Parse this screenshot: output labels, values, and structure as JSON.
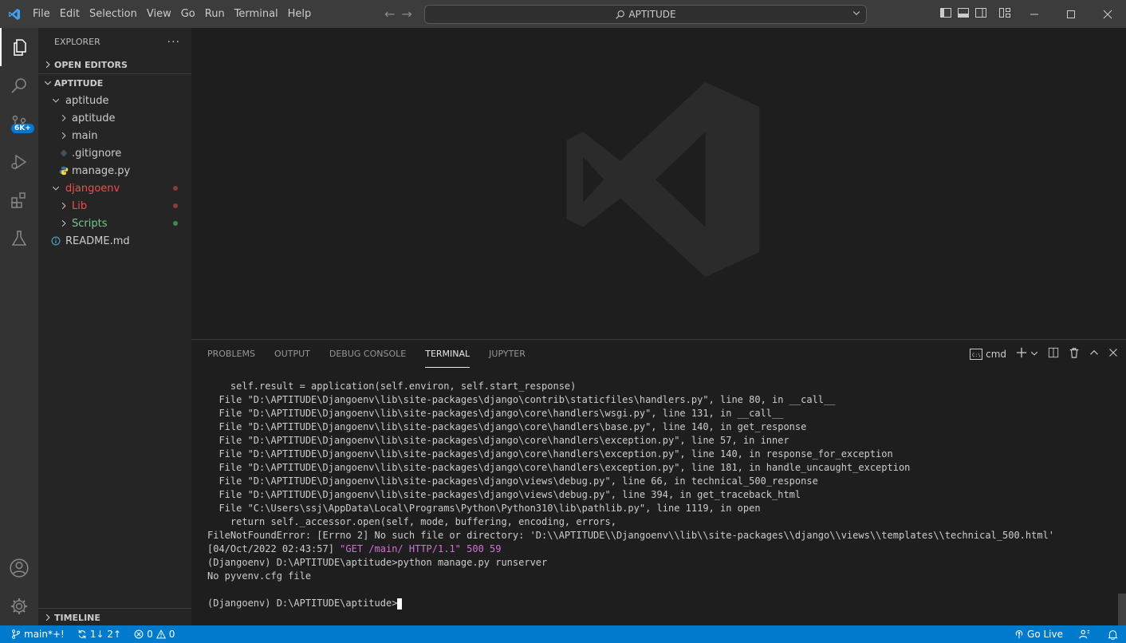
{
  "app": {
    "title": "APTITUDE",
    "accent": "#007acc"
  },
  "menu": [
    {
      "label": "File",
      "key": "F"
    },
    {
      "label": "Edit",
      "key": "E"
    },
    {
      "label": "Selection",
      "key": "S"
    },
    {
      "label": "View",
      "key": "V"
    },
    {
      "label": "Go",
      "key": "G"
    },
    {
      "label": "Run",
      "key": "R"
    },
    {
      "label": "Terminal",
      "key": "T"
    },
    {
      "label": "Help",
      "key": "H"
    }
  ],
  "command_center": {
    "label": "APTITUDE"
  },
  "activity": {
    "scm_badge": "6K+"
  },
  "explorer": {
    "title": "EXPLORER",
    "more": "···",
    "open_editors": "OPEN EDITORS",
    "workspace": "APTITUDE",
    "tree": [
      {
        "label": "aptitude",
        "color": "#cccccc"
      },
      {
        "label": "aptitude",
        "color": "#cccccc"
      },
      {
        "label": "main",
        "color": "#cccccc"
      },
      {
        "label": ".gitignore",
        "color": "#cccccc"
      },
      {
        "label": "manage.py",
        "color": "#cccccc"
      },
      {
        "label": "djangoenv",
        "color": "#f14c4c"
      },
      {
        "label": "Lib",
        "color": "#f14c4c"
      },
      {
        "label": "Scripts",
        "color": "#73c991"
      },
      {
        "label": "README.md",
        "color": "#cccccc"
      }
    ],
    "timeline": "TIMELINE"
  },
  "panel": {
    "tabs": [
      "PROBLEMS",
      "OUTPUT",
      "DEBUG CONSOLE",
      "TERMINAL",
      "JUPYTER"
    ],
    "active_tab": "TERMINAL",
    "shell": "cmd"
  },
  "terminal": {
    "lines": [
      "    self.result = application(self.environ, self.start_response)",
      "  File \"D:\\APTITUDE\\Djangoenv\\lib\\site-packages\\django\\contrib\\staticfiles\\handlers.py\", line 80, in __call__",
      "  File \"D:\\APTITUDE\\Djangoenv\\lib\\site-packages\\django\\core\\handlers\\wsgi.py\", line 131, in __call__",
      "  File \"D:\\APTITUDE\\Djangoenv\\lib\\site-packages\\django\\core\\handlers\\base.py\", line 140, in get_response",
      "  File \"D:\\APTITUDE\\Djangoenv\\lib\\site-packages\\django\\core\\handlers\\exception.py\", line 57, in inner",
      "  File \"D:\\APTITUDE\\Djangoenv\\lib\\site-packages\\django\\core\\handlers\\exception.py\", line 140, in response_for_exception",
      "  File \"D:\\APTITUDE\\Djangoenv\\lib\\site-packages\\django\\core\\handlers\\exception.py\", line 181, in handle_uncaught_exception",
      "  File \"D:\\APTITUDE\\Djangoenv\\lib\\site-packages\\django\\views\\debug.py\", line 66, in technical_500_response",
      "  File \"D:\\APTITUDE\\Djangoenv\\lib\\site-packages\\django\\views\\debug.py\", line 394, in get_traceback_html",
      "  File \"C:\\Users\\ssj\\AppData\\Local\\Programs\\Python\\Python310\\lib\\pathlib.py\", line 1119, in open",
      "    return self._accessor.open(self, mode, buffering, encoding, errors,",
      "FileNotFoundError: [Errno 2] No such file or directory: 'D:\\\\APTITUDE\\\\Djangoenv\\\\lib\\\\site-packages\\\\django\\\\views\\\\templates\\\\technical_500.html'"
    ],
    "log_prefix": "[04/Oct/2022 02:43:57] ",
    "log_request": "\"GET /main/ HTTP/1.1\" 500 59",
    "blank": "",
    "command_line": "(Djangoenv) D:\\APTITUDE\\aptitude>python manage.py runserver",
    "output_line": "No pyvenv.cfg file",
    "prompt": "(Djangoenv) D:\\APTITUDE\\aptitude>"
  },
  "status": {
    "branch": "main*+!",
    "sync": "1↓ 2↑",
    "errors": "0",
    "warnings": "0",
    "go_live": "Go Live"
  }
}
